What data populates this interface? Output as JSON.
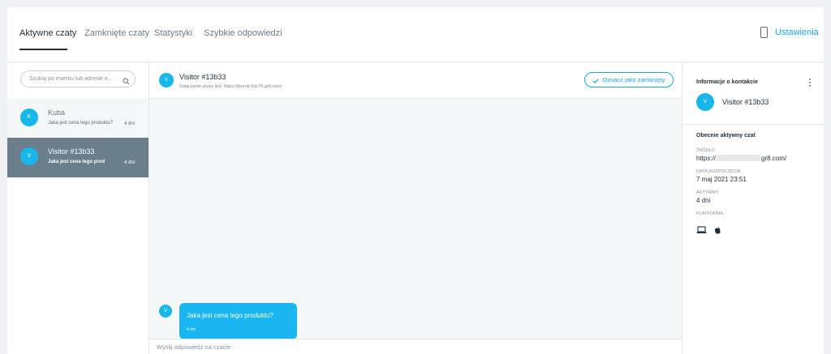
{
  "nav": {
    "tabs": [
      {
        "label": "Aktywne czaty",
        "active": true
      },
      {
        "label": "Zamknięte czaty",
        "active": false
      },
      {
        "label": "Statystyki",
        "active": false
      },
      {
        "label": "Szybkie odpowiedzi",
        "active": false
      }
    ],
    "settings_label": "Ustawienia",
    "settings_icon": "phone-icon"
  },
  "sidebar": {
    "search_placeholder": "Szukaj po imieniu lub adresie e...",
    "chats": [
      {
        "initial": "K",
        "name": "Kuba",
        "last_message": "Jaka jest cena tego produktu?",
        "time": "4 dni",
        "selected": false
      },
      {
        "initial": "V",
        "name": "Visitor #13b33",
        "last_message": "Jaka jest cena tego prod",
        "time": "4 dni",
        "selected": true
      }
    ]
  },
  "conversation": {
    "initial": "V",
    "title": "Visitor #13b33",
    "link_text": "Dołączenie przez link: https://jbronk-5dc79.gr8.com/",
    "close_button": "Oznacz jako zamknięty",
    "messages": [
      {
        "initial": "V",
        "text": "Jaka jest cena tego produktu?",
        "time": "4 dni"
      }
    ],
    "reply_placeholder": "Wyślij odpowiedź na czacie"
  },
  "contact": {
    "title": "Informacje o kontakcie",
    "initial": "V",
    "name": "Visitor #13b33",
    "active_section": "Obecnie aktywny czat",
    "source_label": "Źródło",
    "source_prefix": "https://",
    "source_suffix": "gr8.com/",
    "start_label": "Data rozpoczęcia",
    "start_value": "7 maj 2021 23:51",
    "active_label": "Aktywny",
    "active_value": "4 dni",
    "platform_label": "Platforma",
    "platform_icons": [
      "laptop-icon",
      "apple-icon"
    ]
  },
  "colors": {
    "accent": "#19a5e8",
    "avatar": "#17b7ec",
    "selected_row": "#6a7e8c",
    "bubble": "#19b6f2"
  }
}
